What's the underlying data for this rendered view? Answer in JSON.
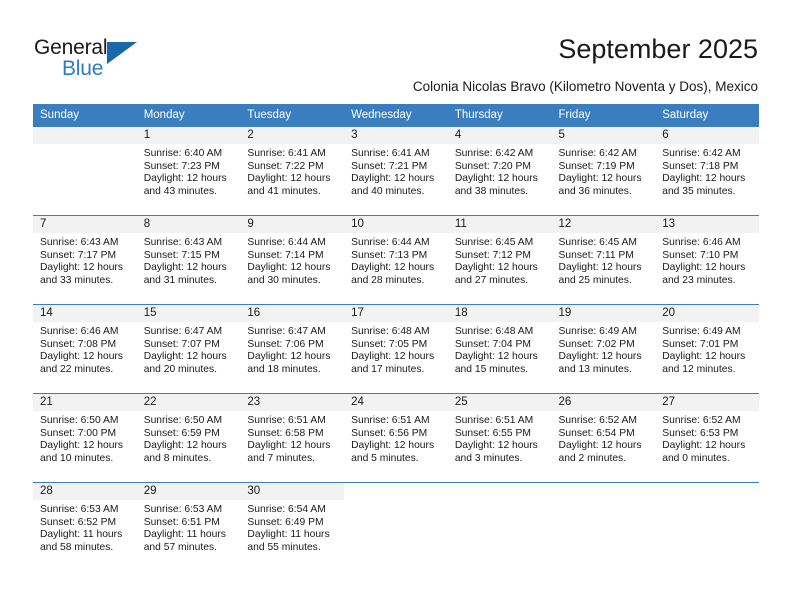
{
  "brand": {
    "name_part1": "General",
    "name_part2": "Blue",
    "triangle_icon": "triangle-logo-icon",
    "accent_color": "#2b7cc4",
    "triangle_color": "#1a68ab"
  },
  "header": {
    "title": "September 2025",
    "subtitle": "Colonia Nicolas Bravo (Kilometro Noventa y Dos), Mexico"
  },
  "calendar": {
    "header_bg": "#3a7ebf",
    "daynum_bg": "#f2f2f2",
    "weekdays": [
      "Sunday",
      "Monday",
      "Tuesday",
      "Wednesday",
      "Thursday",
      "Friday",
      "Saturday"
    ],
    "weeks": [
      [
        {
          "day": "",
          "sunrise": "",
          "sunset": "",
          "daylight1": "",
          "daylight2": ""
        },
        {
          "day": "1",
          "sunrise": "Sunrise: 6:40 AM",
          "sunset": "Sunset: 7:23 PM",
          "daylight1": "Daylight: 12 hours",
          "daylight2": "and 43 minutes."
        },
        {
          "day": "2",
          "sunrise": "Sunrise: 6:41 AM",
          "sunset": "Sunset: 7:22 PM",
          "daylight1": "Daylight: 12 hours",
          "daylight2": "and 41 minutes."
        },
        {
          "day": "3",
          "sunrise": "Sunrise: 6:41 AM",
          "sunset": "Sunset: 7:21 PM",
          "daylight1": "Daylight: 12 hours",
          "daylight2": "and 40 minutes."
        },
        {
          "day": "4",
          "sunrise": "Sunrise: 6:42 AM",
          "sunset": "Sunset: 7:20 PM",
          "daylight1": "Daylight: 12 hours",
          "daylight2": "and 38 minutes."
        },
        {
          "day": "5",
          "sunrise": "Sunrise: 6:42 AM",
          "sunset": "Sunset: 7:19 PM",
          "daylight1": "Daylight: 12 hours",
          "daylight2": "and 36 minutes."
        },
        {
          "day": "6",
          "sunrise": "Sunrise: 6:42 AM",
          "sunset": "Sunset: 7:18 PM",
          "daylight1": "Daylight: 12 hours",
          "daylight2": "and 35 minutes."
        }
      ],
      [
        {
          "day": "7",
          "sunrise": "Sunrise: 6:43 AM",
          "sunset": "Sunset: 7:17 PM",
          "daylight1": "Daylight: 12 hours",
          "daylight2": "and 33 minutes."
        },
        {
          "day": "8",
          "sunrise": "Sunrise: 6:43 AM",
          "sunset": "Sunset: 7:15 PM",
          "daylight1": "Daylight: 12 hours",
          "daylight2": "and 31 minutes."
        },
        {
          "day": "9",
          "sunrise": "Sunrise: 6:44 AM",
          "sunset": "Sunset: 7:14 PM",
          "daylight1": "Daylight: 12 hours",
          "daylight2": "and 30 minutes."
        },
        {
          "day": "10",
          "sunrise": "Sunrise: 6:44 AM",
          "sunset": "Sunset: 7:13 PM",
          "daylight1": "Daylight: 12 hours",
          "daylight2": "and 28 minutes."
        },
        {
          "day": "11",
          "sunrise": "Sunrise: 6:45 AM",
          "sunset": "Sunset: 7:12 PM",
          "daylight1": "Daylight: 12 hours",
          "daylight2": "and 27 minutes."
        },
        {
          "day": "12",
          "sunrise": "Sunrise: 6:45 AM",
          "sunset": "Sunset: 7:11 PM",
          "daylight1": "Daylight: 12 hours",
          "daylight2": "and 25 minutes."
        },
        {
          "day": "13",
          "sunrise": "Sunrise: 6:46 AM",
          "sunset": "Sunset: 7:10 PM",
          "daylight1": "Daylight: 12 hours",
          "daylight2": "and 23 minutes."
        }
      ],
      [
        {
          "day": "14",
          "sunrise": "Sunrise: 6:46 AM",
          "sunset": "Sunset: 7:08 PM",
          "daylight1": "Daylight: 12 hours",
          "daylight2": "and 22 minutes."
        },
        {
          "day": "15",
          "sunrise": "Sunrise: 6:47 AM",
          "sunset": "Sunset: 7:07 PM",
          "daylight1": "Daylight: 12 hours",
          "daylight2": "and 20 minutes."
        },
        {
          "day": "16",
          "sunrise": "Sunrise: 6:47 AM",
          "sunset": "Sunset: 7:06 PM",
          "daylight1": "Daylight: 12 hours",
          "daylight2": "and 18 minutes."
        },
        {
          "day": "17",
          "sunrise": "Sunrise: 6:48 AM",
          "sunset": "Sunset: 7:05 PM",
          "daylight1": "Daylight: 12 hours",
          "daylight2": "and 17 minutes."
        },
        {
          "day": "18",
          "sunrise": "Sunrise: 6:48 AM",
          "sunset": "Sunset: 7:04 PM",
          "daylight1": "Daylight: 12 hours",
          "daylight2": "and 15 minutes."
        },
        {
          "day": "19",
          "sunrise": "Sunrise: 6:49 AM",
          "sunset": "Sunset: 7:02 PM",
          "daylight1": "Daylight: 12 hours",
          "daylight2": "and 13 minutes."
        },
        {
          "day": "20",
          "sunrise": "Sunrise: 6:49 AM",
          "sunset": "Sunset: 7:01 PM",
          "daylight1": "Daylight: 12 hours",
          "daylight2": "and 12 minutes."
        }
      ],
      [
        {
          "day": "21",
          "sunrise": "Sunrise: 6:50 AM",
          "sunset": "Sunset: 7:00 PM",
          "daylight1": "Daylight: 12 hours",
          "daylight2": "and 10 minutes."
        },
        {
          "day": "22",
          "sunrise": "Sunrise: 6:50 AM",
          "sunset": "Sunset: 6:59 PM",
          "daylight1": "Daylight: 12 hours",
          "daylight2": "and 8 minutes."
        },
        {
          "day": "23",
          "sunrise": "Sunrise: 6:51 AM",
          "sunset": "Sunset: 6:58 PM",
          "daylight1": "Daylight: 12 hours",
          "daylight2": "and 7 minutes."
        },
        {
          "day": "24",
          "sunrise": "Sunrise: 6:51 AM",
          "sunset": "Sunset: 6:56 PM",
          "daylight1": "Daylight: 12 hours",
          "daylight2": "and 5 minutes."
        },
        {
          "day": "25",
          "sunrise": "Sunrise: 6:51 AM",
          "sunset": "Sunset: 6:55 PM",
          "daylight1": "Daylight: 12 hours",
          "daylight2": "and 3 minutes."
        },
        {
          "day": "26",
          "sunrise": "Sunrise: 6:52 AM",
          "sunset": "Sunset: 6:54 PM",
          "daylight1": "Daylight: 12 hours",
          "daylight2": "and 2 minutes."
        },
        {
          "day": "27",
          "sunrise": "Sunrise: 6:52 AM",
          "sunset": "Sunset: 6:53 PM",
          "daylight1": "Daylight: 12 hours",
          "daylight2": "and 0 minutes."
        }
      ],
      [
        {
          "day": "28",
          "sunrise": "Sunrise: 6:53 AM",
          "sunset": "Sunset: 6:52 PM",
          "daylight1": "Daylight: 11 hours",
          "daylight2": "and 58 minutes."
        },
        {
          "day": "29",
          "sunrise": "Sunrise: 6:53 AM",
          "sunset": "Sunset: 6:51 PM",
          "daylight1": "Daylight: 11 hours",
          "daylight2": "and 57 minutes."
        },
        {
          "day": "30",
          "sunrise": "Sunrise: 6:54 AM",
          "sunset": "Sunset: 6:49 PM",
          "daylight1": "Daylight: 11 hours",
          "daylight2": "and 55 minutes."
        },
        {
          "day": "",
          "sunrise": "",
          "sunset": "",
          "daylight1": "",
          "daylight2": ""
        },
        {
          "day": "",
          "sunrise": "",
          "sunset": "",
          "daylight1": "",
          "daylight2": ""
        },
        {
          "day": "",
          "sunrise": "",
          "sunset": "",
          "daylight1": "",
          "daylight2": ""
        },
        {
          "day": "",
          "sunrise": "",
          "sunset": "",
          "daylight1": "",
          "daylight2": ""
        }
      ]
    ]
  }
}
